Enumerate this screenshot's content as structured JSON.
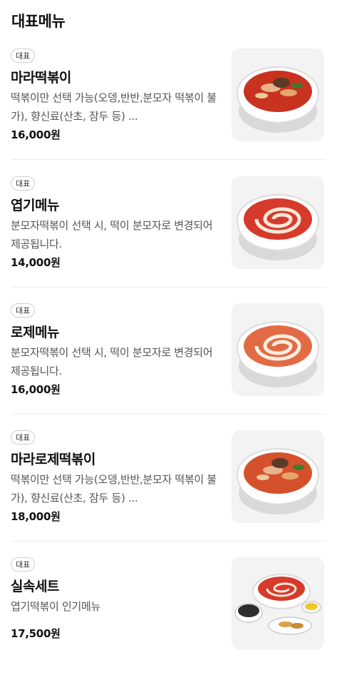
{
  "section": {
    "title": "대표메뉴"
  },
  "items": [
    {
      "badge": "대표",
      "name": "마라떡볶이",
      "desc": "떡볶이만 선택 가능(오뎅,반반,분모자 떡볶이 불가), 향신료(산초, 잠두 등) ...",
      "price": "16,000원",
      "image": "mala-tteokbokki-bowl"
    },
    {
      "badge": "대표",
      "name": "엽기메뉴",
      "desc": "분모자떡볶이 선택 시, 떡이 분모자로 변경되어 제공됩니다.",
      "price": "14,000원",
      "image": "spicy-tteokbokki-bowl"
    },
    {
      "badge": "대표",
      "name": "로제메뉴",
      "desc": "분모자떡볶이 선택 시, 떡이 분모자로 변경되어 제공됩니다.",
      "price": "16,000원",
      "image": "rose-tteokbokki-bowl"
    },
    {
      "badge": "대표",
      "name": "마라로제떡볶이",
      "desc": "떡볶이만 선택 가능(오뎅,반반,분모자 떡볶이 불가), 향신료(산초, 잠두 등) ...",
      "price": "18,000원",
      "image": "mala-rose-tteokbokki-bowl"
    },
    {
      "badge": "대표",
      "name": "실속세트",
      "desc": "엽기떡볶이 인기메뉴",
      "price": "17,500원",
      "image": "set-meal-plate"
    }
  ]
}
